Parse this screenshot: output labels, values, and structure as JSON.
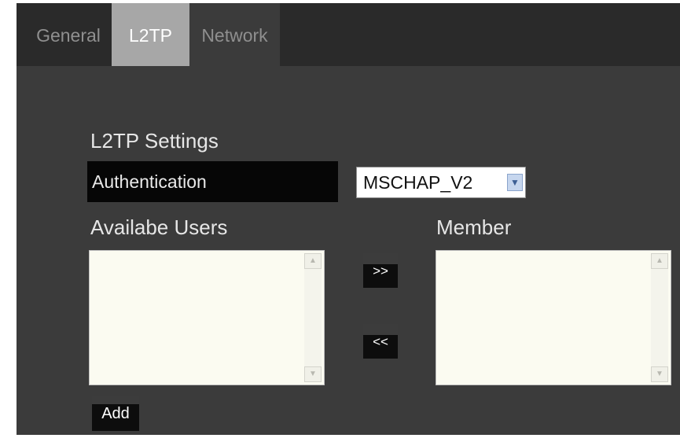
{
  "tabs": [
    {
      "label": "General",
      "active": false
    },
    {
      "label": "L2TP",
      "active": true
    },
    {
      "label": "Network",
      "active": false
    }
  ],
  "section": {
    "title": "L2TP Settings"
  },
  "authentication": {
    "label": "Authentication",
    "selected": "MSCHAP_V2"
  },
  "available_users": {
    "label": "Availabe Users",
    "items": []
  },
  "member": {
    "label": "Member",
    "items": []
  },
  "buttons": {
    "add_to_member": ">>",
    "remove_from_member": "<<",
    "add": "Add"
  },
  "icons": {
    "select_arrow": "chevron-down-icon",
    "scroll_up": "scroll-up-arrow-icon",
    "scroll_down": "scroll-down-arrow-icon"
  },
  "colors": {
    "panel_bg": "#3b3b3b",
    "tabbar_bg": "#2a2a2a",
    "active_tab_bg": "#a7a7a7",
    "button_bg": "#0d0d0d",
    "list_bg": "#fbfbf1"
  }
}
